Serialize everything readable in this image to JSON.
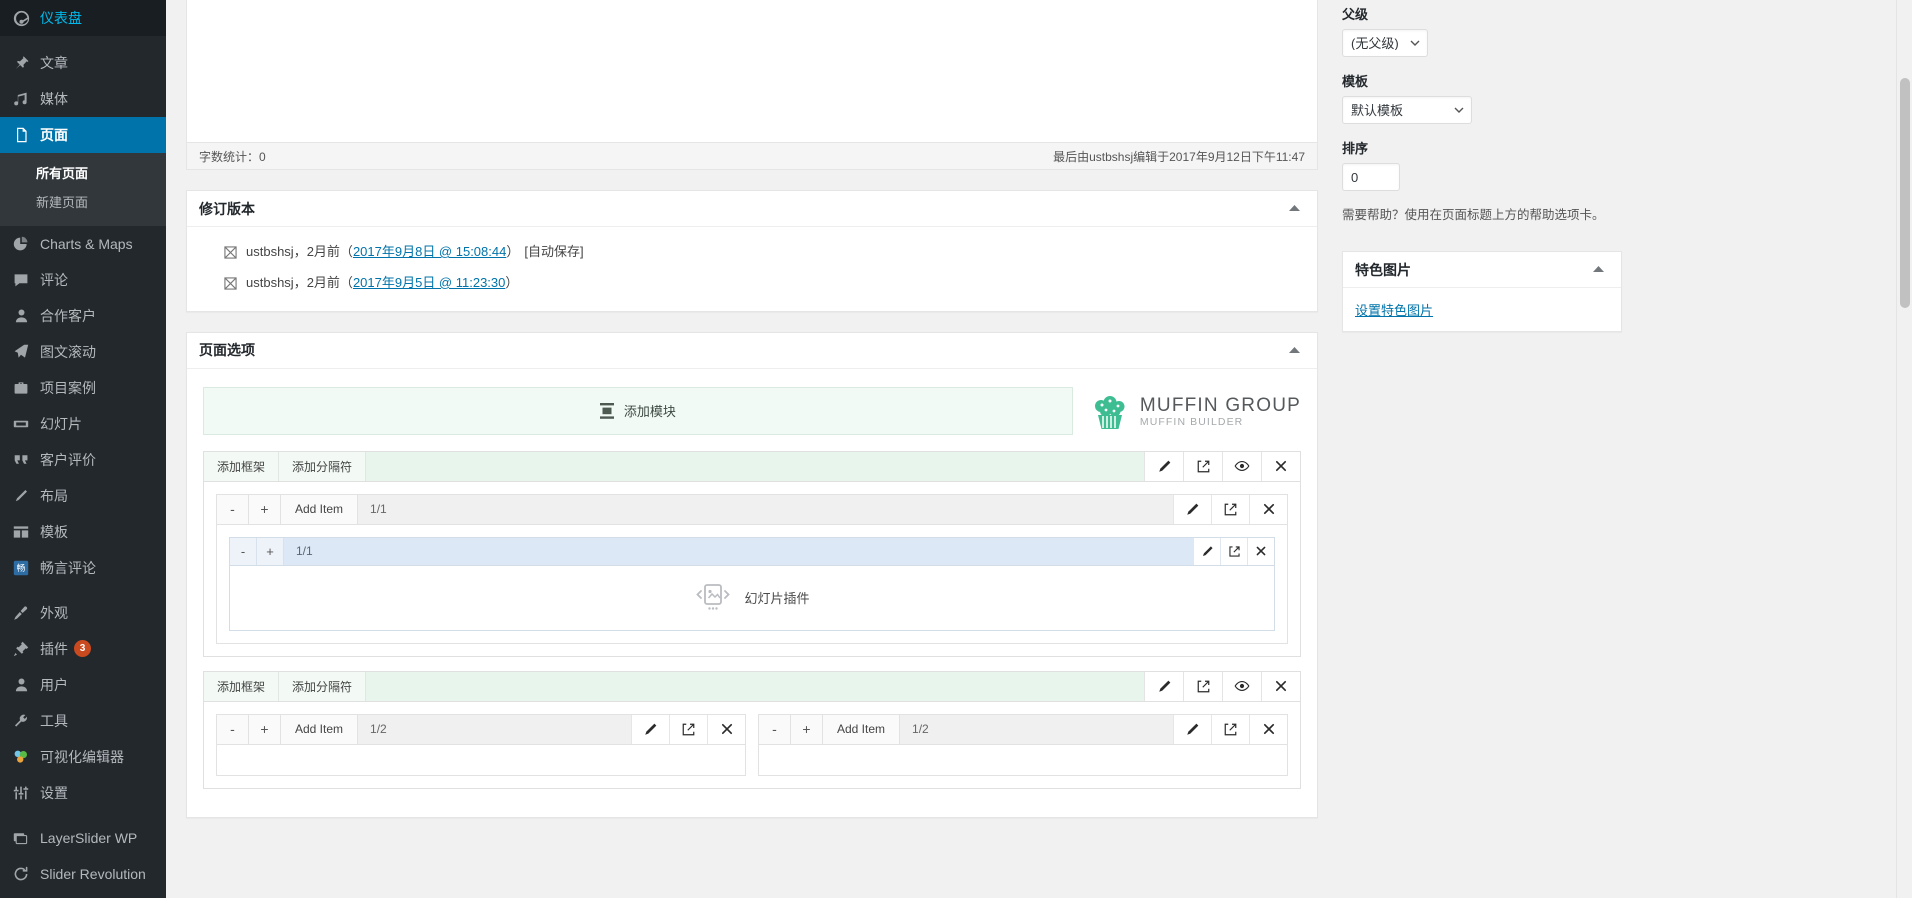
{
  "sidebar": {
    "items": [
      {
        "label": "仪表盘",
        "icon": "dashboard-icon",
        "current": false
      },
      {
        "sep": true
      },
      {
        "label": "文章",
        "icon": "pin-icon",
        "current": false
      },
      {
        "label": "媒体",
        "icon": "media-icon",
        "current": false
      },
      {
        "label": "页面",
        "icon": "page-icon",
        "current": true
      },
      {
        "label": "Charts & Maps",
        "icon": "chart-pie-icon",
        "current": false
      },
      {
        "label": "评论",
        "icon": "comment-icon",
        "current": false
      },
      {
        "label": "合作客户",
        "icon": "user-icon",
        "current": false
      },
      {
        "label": "图文滚动",
        "icon": "scroll-icon",
        "current": false
      },
      {
        "label": "项目案例",
        "icon": "portfolio-icon",
        "current": false
      },
      {
        "label": "幻灯片",
        "icon": "slider-icon",
        "current": false
      },
      {
        "label": "客户评价",
        "icon": "quote-icon",
        "current": false
      },
      {
        "label": "布局",
        "icon": "pencil-icon",
        "current": false
      },
      {
        "label": "模板",
        "icon": "layout-icon",
        "current": false
      },
      {
        "label": "畅言评论",
        "icon": "changyan-icon",
        "current": false
      },
      {
        "sep": true
      },
      {
        "label": "外观",
        "icon": "brush-icon",
        "current": false
      },
      {
        "label": "插件",
        "icon": "plugin-icon",
        "current": false,
        "badge": "3"
      },
      {
        "label": "用户",
        "icon": "users-icon",
        "current": false
      },
      {
        "label": "工具",
        "icon": "wrench-icon",
        "current": false
      },
      {
        "label": "可视化编辑器",
        "icon": "visual-editor-icon",
        "current": false
      },
      {
        "label": "设置",
        "icon": "settings-icon",
        "current": false
      },
      {
        "sep": true
      },
      {
        "label": "LayerSlider WP",
        "icon": "layerslider-icon",
        "current": false
      },
      {
        "label": "Slider Revolution",
        "icon": "revolution-icon",
        "current": false
      }
    ],
    "submenu": {
      "parent": "页面",
      "items": [
        {
          "label": "所有页面",
          "current": true
        },
        {
          "label": "新建页面",
          "current": false
        }
      ]
    }
  },
  "editor": {
    "word_count_label": "字数统计：0",
    "last_edited": "最后由ustbshsj编辑于2017年9月12日下午11:47"
  },
  "revisions": {
    "title": "修订版本",
    "rows": [
      {
        "author": "ustbshsj",
        "ago": "，2月前（",
        "link": "2017年9月8日 @ 15:08:44",
        "close": "）",
        "note": "[自动保存]"
      },
      {
        "author": "ustbshsj",
        "ago": "，2月前（",
        "link": "2017年9月5日 @ 11:23:30",
        "close": "）",
        "note": ""
      }
    ]
  },
  "page_options": {
    "title": "页面选项",
    "add_module_label": "添加模块",
    "logo": {
      "line1": "MUFFIN GROUP",
      "line2": "MUFFIN BUILDER",
      "accent_color": "#3ebd93"
    },
    "labels": {
      "add_wrapper": "添加框架",
      "add_divider": "添加分隔符",
      "add_item": "Add Item",
      "minus": "-",
      "plus": "+"
    },
    "wrappers": [
      {
        "items": [
          {
            "ratio": "1/1",
            "modules": [
              {
                "ratio": "1/1",
                "label": "幻灯片插件",
                "icon": "slider-module-icon"
              }
            ]
          }
        ]
      },
      {
        "items": [
          {
            "ratio": "1/2",
            "modules": []
          },
          {
            "ratio": "1/2",
            "modules": []
          }
        ]
      }
    ]
  },
  "side": {
    "attributes": {
      "parent_label": "父级",
      "parent_value": "(无父级)",
      "parent_options": [
        "(无父级)"
      ],
      "template_label": "模板",
      "template_value": "默认模板",
      "template_options": [
        "默认模板"
      ],
      "order_label": "排序",
      "order_value": "0",
      "help": "需要帮助？使用在页面标题上方的帮助选项卡。"
    },
    "featured": {
      "title": "特色图片",
      "link": "设置特色图片"
    }
  }
}
